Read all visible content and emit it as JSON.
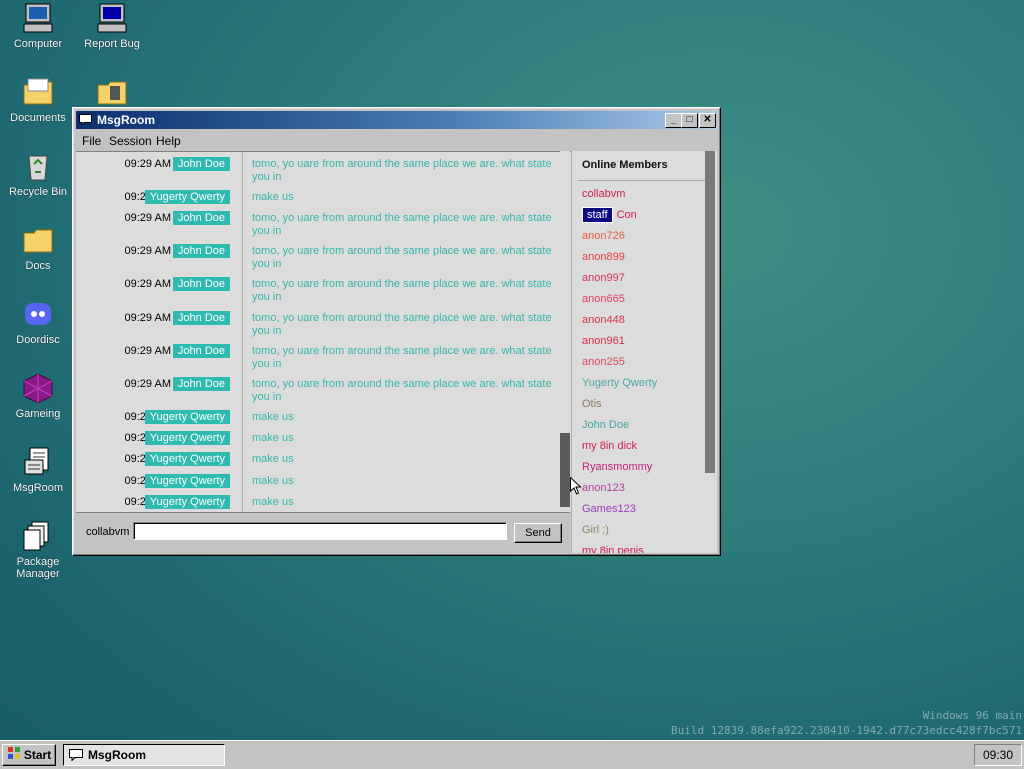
{
  "desktop": {
    "icons": [
      {
        "label": "Computer",
        "icon": "computer-icon"
      },
      {
        "label": "Report Bug",
        "icon": "report-bug-icon"
      },
      {
        "label": "Documents",
        "icon": "documents-folder-icon"
      },
      {
        "label": "",
        "icon": "tools-folder-icon"
      },
      {
        "label": "Recycle Bin",
        "icon": "recycle-bin-icon"
      },
      {
        "label": "Docs",
        "icon": "docs-folder-icon"
      },
      {
        "label": "Doordisc",
        "icon": "doordisc-icon"
      },
      {
        "label": "Gameing",
        "icon": "gameing-icon"
      },
      {
        "label": "MsgRoom",
        "icon": "msgroom-icon"
      },
      {
        "label": "Package Manager",
        "icon": "package-manager-icon"
      }
    ]
  },
  "window": {
    "title": "MsgRoom",
    "menu": [
      "File",
      "Session",
      "Help"
    ],
    "messages": [
      {
        "time": "09:29 AM",
        "user": "John Doe",
        "text": "tomo, yo uare from around the same place we are. what state you in"
      },
      {
        "time": "09:29 AM",
        "user": "Yugerty Qwerty",
        "text": "make us"
      },
      {
        "time": "09:29 AM",
        "user": "John Doe",
        "text": "tomo, yo uare from around the same place we are. what state you in"
      },
      {
        "time": "09:29 AM",
        "user": "John Doe",
        "text": "tomo, yo uare from around the same place we are. what state you in"
      },
      {
        "time": "09:29 AM",
        "user": "John Doe",
        "text": "tomo, yo uare from around the same place we are. what state you in"
      },
      {
        "time": "09:29 AM",
        "user": "John Doe",
        "text": "tomo, yo uare from around the same place we are. what state you in"
      },
      {
        "time": "09:29 AM",
        "user": "John Doe",
        "text": "tomo, yo uare from around the same place we are. what state you in"
      },
      {
        "time": "09:29 AM",
        "user": "John Doe",
        "text": "tomo, yo uare from around the same place we are. what state you in"
      },
      {
        "time": "09:29 AM",
        "user": "Yugerty Qwerty",
        "text": "make us"
      },
      {
        "time": "09:29 AM",
        "user": "Yugerty Qwerty",
        "text": "make us"
      },
      {
        "time": "09:29 AM",
        "user": "Yugerty Qwerty",
        "text": "make us"
      },
      {
        "time": "09:29 AM",
        "user": "Yugerty Qwerty",
        "text": "make us"
      },
      {
        "time": "09:29 AM",
        "user": "Yugerty Qwerty",
        "text": "make us"
      }
    ],
    "members_title": "Online Members",
    "members": [
      {
        "name": "collabvm",
        "color": "#d0204a"
      },
      {
        "name": "Con",
        "color": "#d0204a",
        "badge": "staff"
      },
      {
        "name": "anon726",
        "color": "#e0603a"
      },
      {
        "name": "anon899",
        "color": "#e04040"
      },
      {
        "name": "anon997",
        "color": "#d83058"
      },
      {
        "name": "anon665",
        "color": "#e04060"
      },
      {
        "name": "anon448",
        "color": "#d83048"
      },
      {
        "name": "anon961",
        "color": "#d83048"
      },
      {
        "name": "anon255",
        "color": "#e04860"
      },
      {
        "name": "Yugerty Qwerty",
        "color": "#4aa8a0"
      },
      {
        "name": "Otis",
        "color": "#8a7a6a"
      },
      {
        "name": "John Doe",
        "color": "#3aa8a0"
      },
      {
        "name": "my 8in dick",
        "color": "#d02050"
      },
      {
        "name": "Ryansmommy",
        "color": "#c82080"
      },
      {
        "name": "anon123",
        "color": "#b040a0"
      },
      {
        "name": "Games123",
        "color": "#9a40b8"
      },
      {
        "name": "Girl ;)",
        "color": "#8a8a6a"
      },
      {
        "name": "my 8in penis",
        "color": "#d02050"
      }
    ],
    "input": {
      "nickname": "collabvm",
      "value": "",
      "send_label": "Send"
    }
  },
  "taskbar": {
    "start_label": "Start",
    "task_label": "MsgRoom",
    "clock": "09:30"
  },
  "watermark": {
    "line1": "Windows 96 main",
    "line2": "Build 12839.88efa922.230410-1942.d77c73edcc428f7bc571"
  },
  "colors": {
    "user_badge": "#2fbab0",
    "message_text": "#36b5aa",
    "staff_badge": "#0a0a80"
  }
}
